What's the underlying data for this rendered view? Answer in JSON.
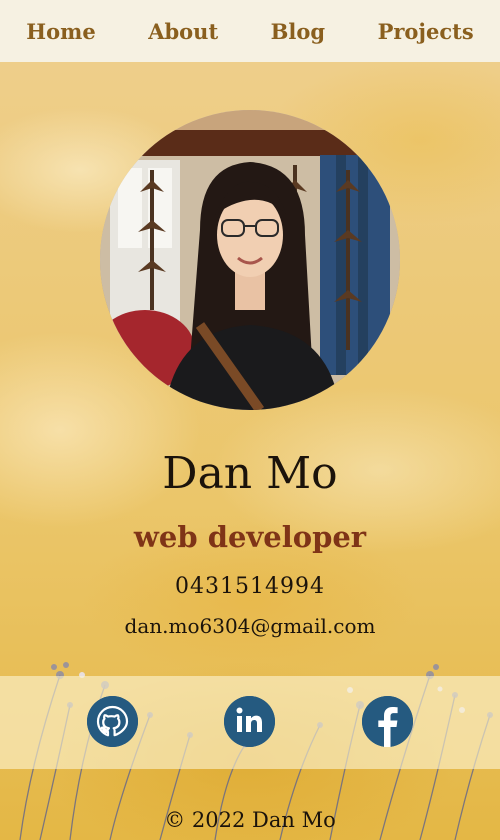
{
  "nav": {
    "items": [
      {
        "label": "Home"
      },
      {
        "label": "About"
      },
      {
        "label": "Blog"
      },
      {
        "label": "Projects"
      }
    ]
  },
  "profile": {
    "name": "Dan Mo",
    "role": "web developer",
    "phone": "0431514994",
    "email": "dan.mo6304@gmail.com"
  },
  "social": {
    "links": [
      {
        "icon": "github-icon"
      },
      {
        "icon": "linkedin-icon"
      },
      {
        "icon": "facebook-icon"
      }
    ]
  },
  "footer": {
    "text": "© 2022 Dan Mo"
  },
  "colors": {
    "nav_bg": "#f6f1e2",
    "nav_text": "#8a5f1e",
    "role": "#7f3417",
    "social_icon_bg": "#255a80"
  }
}
